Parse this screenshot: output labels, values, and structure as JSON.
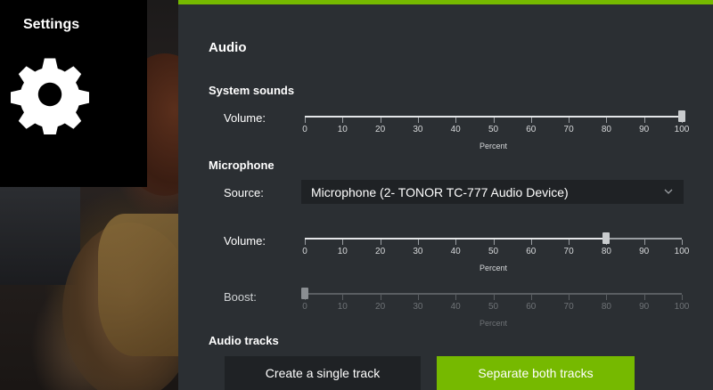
{
  "sidebar": {
    "title": "Settings",
    "icon": "gear-icon"
  },
  "colors": {
    "accent": "#76b900",
    "panel": "#2b2f33",
    "input": "#1f2225"
  },
  "audio": {
    "heading": "Audio",
    "system_sounds": {
      "heading": "System sounds",
      "volume_label": "Volume:",
      "volume_value": 100
    },
    "microphone": {
      "heading": "Microphone",
      "source_label": "Source:",
      "source_value": "Microphone (2- TONOR TC-777 Audio Device)",
      "volume_label": "Volume:",
      "volume_value": 80,
      "boost_label": "Boost:",
      "boost_value": 0,
      "boost_enabled": false
    },
    "scale": {
      "ticks": [
        "0",
        "10",
        "20",
        "30",
        "40",
        "50",
        "60",
        "70",
        "80",
        "90",
        "100"
      ],
      "caption": "Percent"
    },
    "tracks": {
      "heading": "Audio tracks",
      "single_label": "Create a single track",
      "separate_label": "Separate both tracks",
      "selected": "separate"
    }
  }
}
